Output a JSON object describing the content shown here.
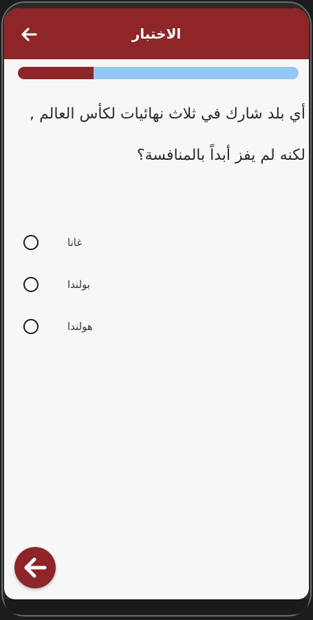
{
  "app_bar": {
    "title": "الاختبار",
    "back_icon": "arrow-left-icon"
  },
  "progress": {
    "value": 0.27,
    "fill_color": "#8e2528",
    "track_color": "#93c8f4"
  },
  "question": {
    "text": "أي بلد شارك في ثلاث نهائيات لكأس العالم , لكنه لم يفز أبداً بالمنافسة؟"
  },
  "options": [
    {
      "label": "غانا",
      "selected": false
    },
    {
      "label": "بولندا",
      "selected": false
    },
    {
      "label": "هولندا",
      "selected": false
    }
  ],
  "fab": {
    "icon": "arrow-left-icon",
    "color": "#8e2528"
  },
  "colors": {
    "primary": "#8e2528",
    "background": "#f7f7f7"
  }
}
